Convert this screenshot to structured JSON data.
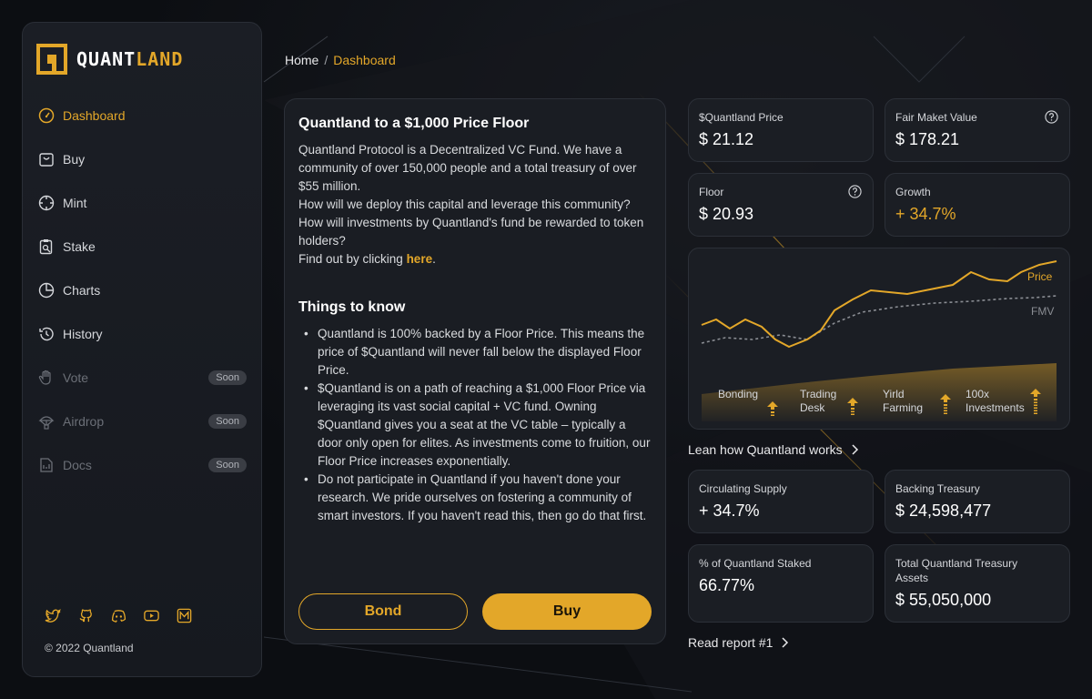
{
  "brand": {
    "name_part1": "QUANT",
    "name_part2": "LAND",
    "accent": "#e3a729"
  },
  "sidebar": {
    "items": [
      {
        "label": "Dashboard",
        "icon": "gauge-icon",
        "active": true
      },
      {
        "label": "Buy",
        "icon": "shopping-bag-icon"
      },
      {
        "label": "Mint",
        "icon": "crosshair-icon"
      },
      {
        "label": "Stake",
        "icon": "clipboard-search-icon"
      },
      {
        "label": "Charts",
        "icon": "pie-chart-icon"
      },
      {
        "label": "History",
        "icon": "history-icon"
      },
      {
        "label": "Vote",
        "icon": "hand-icon",
        "badge": "Soon"
      },
      {
        "label": "Airdrop",
        "icon": "parachute-icon",
        "badge": "Soon"
      },
      {
        "label": "Docs",
        "icon": "document-icon",
        "badge": "Soon"
      }
    ],
    "social": [
      "twitter-icon",
      "github-icon",
      "discord-icon",
      "youtube-icon",
      "medium-icon"
    ],
    "copyright": "© 2022 Quantland"
  },
  "breadcrumb": {
    "home": "Home",
    "sep": "/",
    "current": "Dashboard"
  },
  "main": {
    "title": "Quantland to a $1,000 Price Floor",
    "intro1": "Quantland Protocol is a Decentralized VC Fund. We have a community of over 150,000 people and a total treasury of over $55 million.",
    "intro2": "How will we deploy this capital and leverage this community? How will investments by Quantland's fund be rewarded to token holders?",
    "intro3_prefix": "Find out by clicking ",
    "intro3_link": "here",
    "intro3_suffix": ".",
    "section_title": "Things to know",
    "bullets": [
      "Quantland is 100% backed by a Floor Price. This means the price of $Quantland will never fall below the displayed Floor Price.",
      "$Quantland is on a path of reaching a $1,000 Floor Price via leveraging its vast social capital + VC fund. Owning $Quantland gives you a seat at the VC table – typically a door only open for elites. As investments come to fruition, our Floor Price increases exponentially.",
      "Do not participate in Quantland if you haven't done your research. We pride ourselves on fostering a community of smart investors. If you haven't read this, then go do that first."
    ],
    "bond_label": "Bond",
    "buy_label": "Buy"
  },
  "stats": {
    "price": {
      "label": "$Quantland Price",
      "value": "$ 21.12"
    },
    "fmv": {
      "label": "Fair Maket Value",
      "value": "$ 178.21"
    },
    "floor": {
      "label": "Floor",
      "value": "$ 20.93"
    },
    "growth": {
      "label": "Growth",
      "value": "+ 34.7%"
    },
    "supply": {
      "label": "Circulating Supply",
      "value": "+ 34.7%"
    },
    "backing": {
      "label": "Backing Treasury",
      "value": "$ 24,598,477"
    },
    "staked": {
      "label": "% of Quantland Staked",
      "value": "66.77%"
    },
    "assets": {
      "label": "Total Quantland Treasury Assets",
      "value": "$ 55,050,000"
    }
  },
  "chart": {
    "price_label": "Price",
    "fmv_label": "FMV",
    "stages": [
      {
        "l1": "",
        "l2": "Bonding"
      },
      {
        "l1": "Trading",
        "l2": "Desk"
      },
      {
        "l1": "Yirld",
        "l2": "Farming"
      },
      {
        "l1": "100x",
        "l2": "Investments"
      }
    ]
  },
  "links": {
    "learn": "Lean how Quantland works",
    "report": "Read report #1"
  }
}
